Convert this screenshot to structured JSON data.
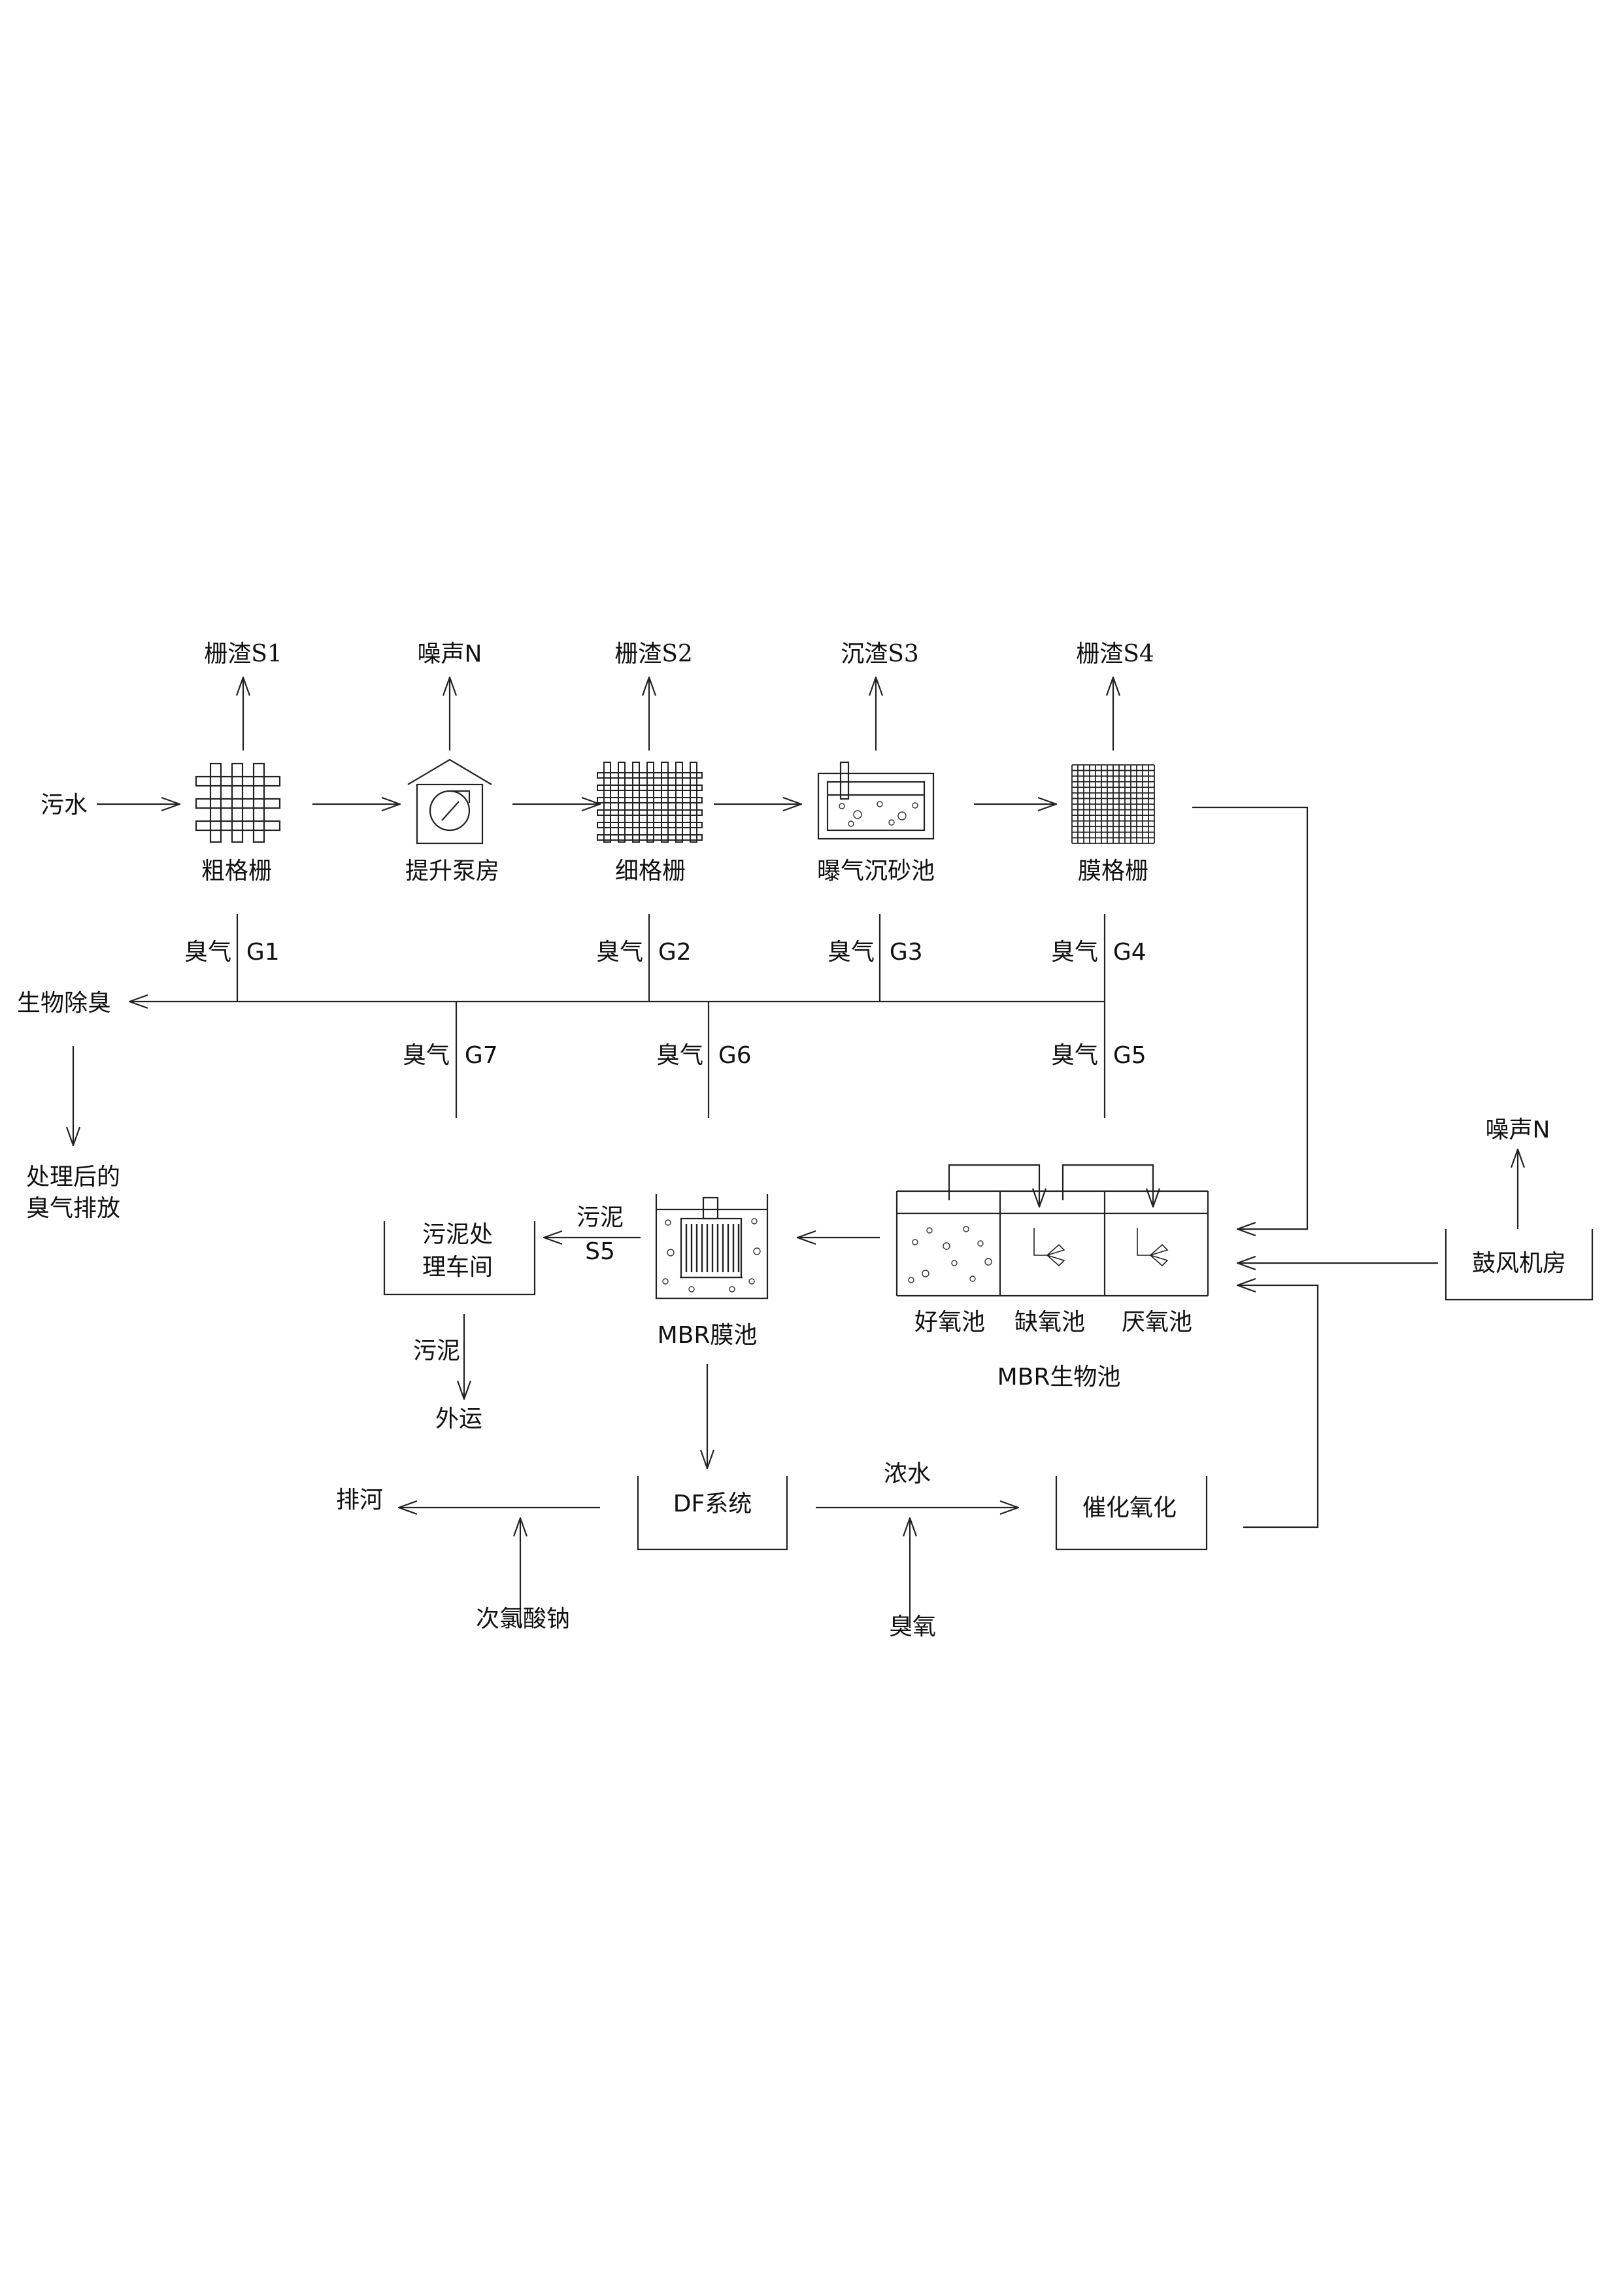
{
  "labels": {
    "input": "污水",
    "s1": "栅渣S1",
    "noise_pump": "噪声N",
    "s2": "栅渣S2",
    "s3": "沉渣S3",
    "s4": "栅渣S4",
    "coarse_screen": "粗格栅",
    "lift_pump": "提升泵房",
    "fine_screen": "细格栅",
    "grit_chamber": "曝气沉砂池",
    "membrane_screen": "膜格栅",
    "g1": "臭气  G1",
    "g2": "臭气  G2",
    "g3": "臭气  G3",
    "g4": "臭气  G4",
    "g5": "臭气  G5",
    "g6": "臭气  G6",
    "g7": "臭气  G7",
    "bio_deodor": "生物除臭",
    "treated_gas_line1": "处理后的",
    "treated_gas_line2": "臭气排放",
    "noise_blower": "噪声N",
    "blower_room": "鼓风机房",
    "aerobic": "好氧池",
    "anoxic": "缺氧池",
    "anaerobic": "厌氧池",
    "mbr_bio": "MBR生物池",
    "mbr_membrane": "MBR膜池",
    "sludge_s5_line1": "污泥",
    "sludge_s5_line2": "S5",
    "sludge_room_line1": "污泥处",
    "sludge_room_line2": "理车间",
    "sludge": "污泥",
    "transport": "外运",
    "df_system": "DF系统",
    "concentrate": "浓水",
    "catalytic_oxidation": "催化氧化",
    "discharge": "排河",
    "hypochlorite": "次氯酸钠",
    "ozone": "臭氧"
  }
}
